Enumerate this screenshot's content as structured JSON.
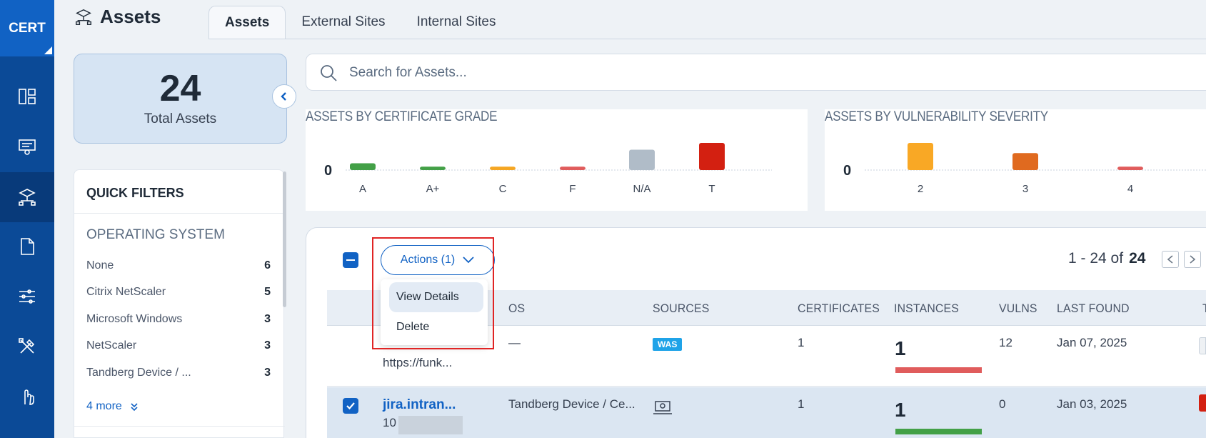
{
  "brand": "CERT",
  "page": {
    "title": "Assets"
  },
  "tabs": [
    {
      "label": "Assets",
      "active": true
    },
    {
      "label": "External Sites",
      "active": false
    },
    {
      "label": "Internal Sites",
      "active": false
    }
  ],
  "summary": {
    "total": "24",
    "label": "Total Assets"
  },
  "search": {
    "placeholder": "Search for Assets..."
  },
  "quick_filters": {
    "title": "QUICK FILTERS",
    "section": "OPERATING SYSTEM",
    "items": [
      {
        "label": "None",
        "count": "6"
      },
      {
        "label": "Citrix NetScaler",
        "count": "5"
      },
      {
        "label": "Microsoft Windows",
        "count": "3"
      },
      {
        "label": "NetScaler",
        "count": "3"
      },
      {
        "label": "Tandberg Device / ...",
        "count": "3"
      }
    ],
    "more": "4 more"
  },
  "chart_data": [
    {
      "type": "bar",
      "title": "ASSETS BY CERTIFICATE GRADE",
      "categories": [
        "A",
        "A+",
        "C",
        "F",
        "N/A",
        "T"
      ],
      "values": [
        2,
        1,
        1,
        1,
        6,
        8
      ],
      "colors": [
        "#43a047",
        "#43a047",
        "#f5a623",
        "#e05c5c",
        "#b0bcc8",
        "#d32011"
      ],
      "ytick": "0"
    },
    {
      "type": "bar",
      "title": "ASSETS BY VULNERABILITY SEVERITY",
      "categories": [
        "2",
        "3",
        "4"
      ],
      "values": [
        8,
        5,
        1
      ],
      "colors": [
        "#f9a825",
        "#e06a1f",
        "#e05c5c"
      ],
      "ytick": "0"
    }
  ],
  "toolbar": {
    "actions_label": "Actions (1)",
    "menu": [
      "View Details",
      "Delete"
    ],
    "pager": {
      "range": "1 - 24 of",
      "total": "24"
    }
  },
  "table": {
    "columns": [
      "OS",
      "SOURCES",
      "CERTIFICATES",
      "INSTANCES",
      "VULNS",
      "LAST FOUND",
      "T"
    ],
    "rows": [
      {
        "name_partial": "https://funk...",
        "os": "—",
        "source": "WAS",
        "certificates": "1",
        "instances": 1,
        "instances_color": "#e05c5c",
        "vulns": "12",
        "last_found": "Jan 07, 2025",
        "checked": false
      },
      {
        "name": "jira.intran...",
        "ip_partial": "10",
        "os": "Tandberg Device / Ce...",
        "source": "agent",
        "certificates": "1",
        "instances": 1,
        "instances_color": "#43a047",
        "vulns": "0",
        "last_found": "Jan 03, 2025",
        "checked": true
      }
    ]
  }
}
